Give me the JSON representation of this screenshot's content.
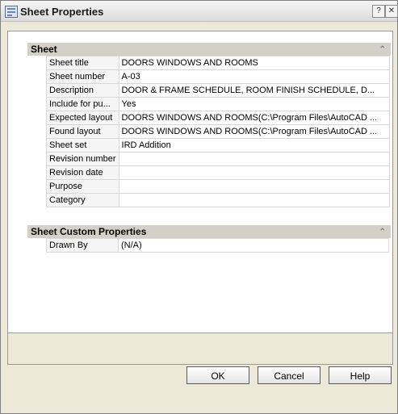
{
  "window": {
    "title": "Sheet Properties",
    "help_glyph": "?",
    "close_glyph": "✕"
  },
  "sections": {
    "sheet": {
      "label": "Sheet",
      "rows": [
        {
          "name": "Sheet title",
          "value": "DOORS WINDOWS AND ROOMS"
        },
        {
          "name": "Sheet number",
          "value": "A-03"
        },
        {
          "name": "Description",
          "value": "DOOR & FRAME SCHEDULE, ROOM FINISH SCHEDULE, D..."
        },
        {
          "name": "Include for pu...",
          "value": "Yes"
        },
        {
          "name": "Expected layout",
          "value": "DOORS WINDOWS AND ROOMS(C:\\Program Files\\AutoCAD ..."
        },
        {
          "name": "Found layout",
          "value": "DOORS WINDOWS AND ROOMS(C:\\Program Files\\AutoCAD ..."
        },
        {
          "name": "Sheet set",
          "value": "IRD Addition"
        },
        {
          "name": "Revision number",
          "value": ""
        },
        {
          "name": "Revision date",
          "value": ""
        },
        {
          "name": "Purpose",
          "value": ""
        },
        {
          "name": "Category",
          "value": ""
        }
      ]
    },
    "custom": {
      "label": "Sheet Custom Properties",
      "rows": [
        {
          "name": "Drawn By",
          "value": "(N/A)"
        }
      ]
    }
  },
  "buttons": {
    "ok": "OK",
    "cancel": "Cancel",
    "help": "Help"
  }
}
